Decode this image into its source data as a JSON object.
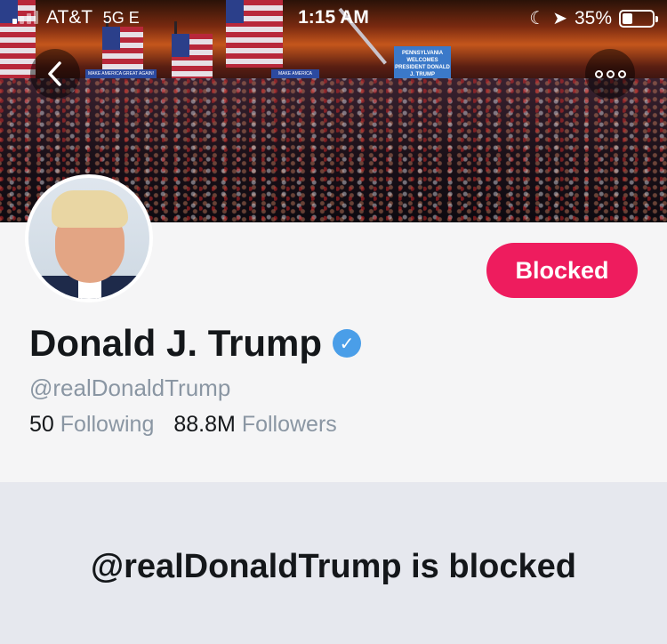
{
  "status_bar": {
    "carrier": "AT&T",
    "network": "5G E",
    "time": "1:15 AM",
    "battery": "35%",
    "battery_level": 0.35
  },
  "header": {
    "stage_sign": "PENNSYLVANIA WELCOMES PRESIDENT DONALD J. TRUMP",
    "banner_text": "MAKE AMERICA GREAT AGAIN!"
  },
  "profile": {
    "name": "Donald J. Trump",
    "verified_glyph": "✓",
    "handle": "@realDonaldTrump",
    "following_count": "50",
    "following_label": "Following",
    "followers_count": "88.8M",
    "followers_label": "Followers",
    "blocked_button": "Blocked"
  },
  "blocked_notice": {
    "title": "@realDonaldTrump is blocked"
  },
  "icons": {
    "back": "chevron-left-icon",
    "more": "more-options-icon",
    "verified": "verified-badge-icon",
    "location": "location-arrow-icon",
    "moon": "do-not-disturb-icon"
  },
  "colors": {
    "accent": "#ee1c5e",
    "verified": "#4a9ee8",
    "muted": "#8a96a3"
  }
}
